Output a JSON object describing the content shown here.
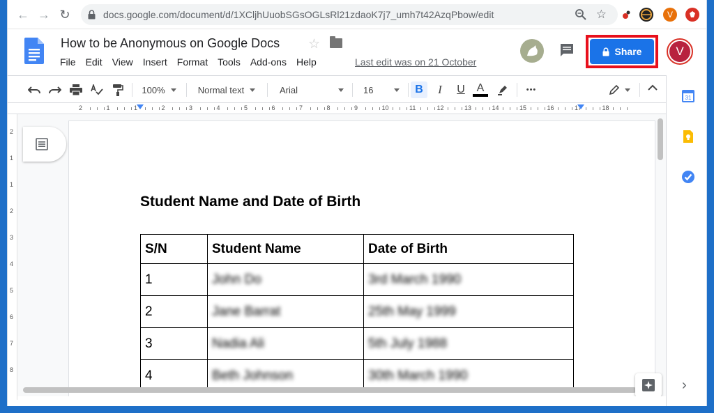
{
  "browser": {
    "url": "docs.google.com/document/d/1XCljhUuobSGsOGLsRl21zdaoK7j7_umh7t42AzqPbow/edit",
    "profile_initial": "V"
  },
  "doc": {
    "title": "How to be Anonymous on Google Docs",
    "last_edit": "Last edit was on 21 October",
    "share_label": "Share",
    "account_initial": "V"
  },
  "menu": [
    "File",
    "Edit",
    "View",
    "Insert",
    "Format",
    "Tools",
    "Add-ons",
    "Help"
  ],
  "toolbar": {
    "zoom": "100%",
    "style": "Normal text",
    "font": "Arial",
    "size": "16",
    "bold": "B",
    "italic": "I",
    "underline": "U",
    "text_color": "A",
    "more": "•••"
  },
  "ruler": {
    "numbers": [
      "2",
      "1",
      "1",
      "2",
      "3",
      "4",
      "5",
      "6",
      "7",
      "8",
      "9",
      "10",
      "11",
      "12",
      "13",
      "14",
      "15",
      "16",
      "17",
      "18"
    ]
  },
  "vruler": {
    "numbers": [
      "2",
      "1",
      "1",
      "2",
      "3",
      "4",
      "5",
      "6",
      "7",
      "8"
    ]
  },
  "content": {
    "heading": "Student Name and Date of Birth",
    "table": {
      "headers": [
        "S/N",
        "Student Name",
        "Date of Birth"
      ],
      "rows": [
        [
          "1",
          "John Do",
          "3rd March 1990"
        ],
        [
          "2",
          "Jane Barrat",
          "25th May 1999"
        ],
        [
          "3",
          "Nadia Ali",
          "5th July 1988"
        ],
        [
          "4",
          "Beth Johnson",
          "30th March 1990"
        ]
      ]
    }
  },
  "side_panel": {
    "calendar_day": "31"
  },
  "colors": {
    "accent": "#1a73e8",
    "highlight": "#e8101c",
    "account": "#b8223e"
  }
}
